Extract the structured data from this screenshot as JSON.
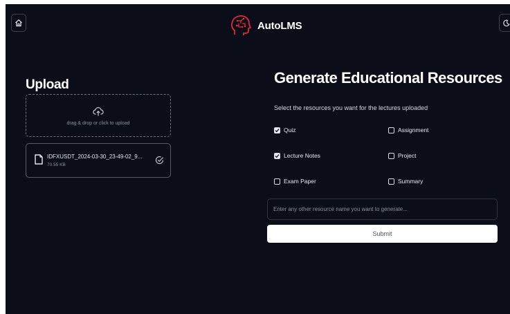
{
  "header": {
    "brand_name": "AutoLMS",
    "home_icon": "home-icon",
    "theme_icon": "moon-icon",
    "logo_icon": "brain-head-icon",
    "brand_color": "#e02b3a"
  },
  "upload": {
    "title": "Upload",
    "dropzone_text": "drag & drop or click to upload",
    "file": {
      "name": "IDFXUSDT_2024-03-30_23-49-02_9...",
      "size": "70.55 KB"
    }
  },
  "generate": {
    "title": "Generate Educational Resources",
    "subtitle": "Select the resources you want for the lectures uploaded",
    "options": [
      {
        "label": "Quiz",
        "checked": true
      },
      {
        "label": "Assignment",
        "checked": false
      },
      {
        "label": "Lecture Notes",
        "checked": true
      },
      {
        "label": "Project",
        "checked": false
      },
      {
        "label": "Exam Paper",
        "checked": false
      },
      {
        "label": "Summary",
        "checked": false
      }
    ],
    "other_placeholder": "Enter any other resource name you want to generate...",
    "other_value": "",
    "submit_label": "Submit"
  }
}
